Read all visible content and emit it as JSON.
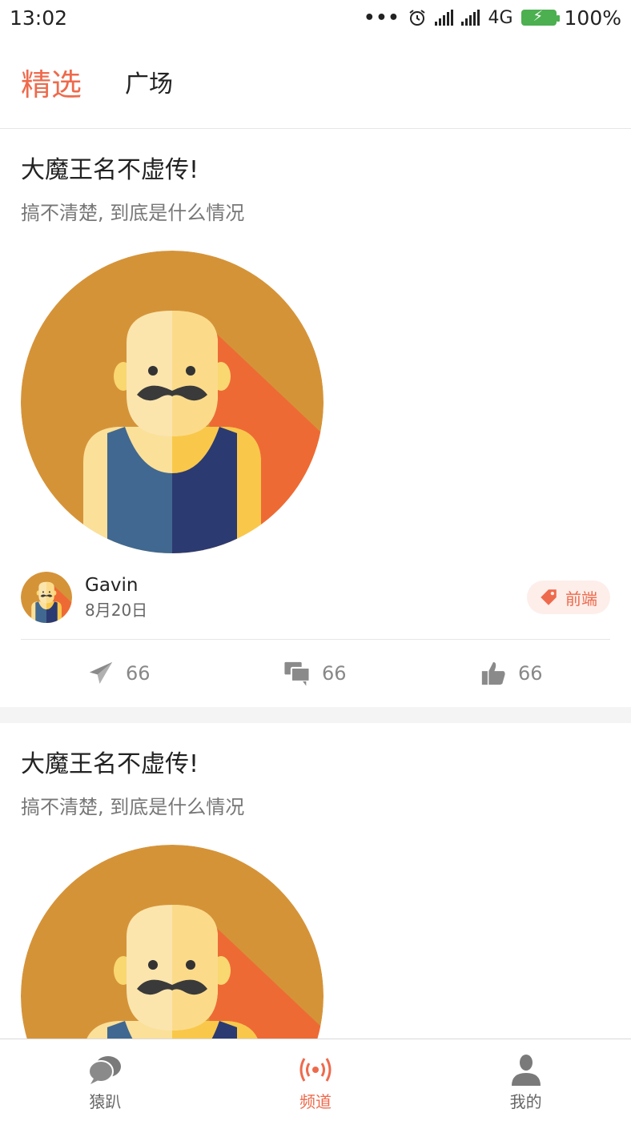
{
  "status_bar": {
    "time": "13:02",
    "dots": "•••",
    "network": "4G",
    "battery": "100%"
  },
  "header": {
    "tabs": [
      {
        "label": "精选",
        "active": true
      },
      {
        "label": "广场",
        "active": false
      }
    ]
  },
  "colors": {
    "accent": "#ee6a4c",
    "avatar_bg": "#d59338",
    "avatar_shadow": "#ee6a34",
    "tank_left": "#416890",
    "tank_right": "#2c3a72"
  },
  "posts": [
    {
      "title": "大魔王名不虚传!",
      "subtitle": "搞不清楚, 到底是什么情况",
      "image_icon": "bald-mustache-man-avatar",
      "author": "Gavin",
      "date": "8月20日",
      "tag": "前端",
      "shares": "66",
      "comments": "66",
      "likes": "66"
    },
    {
      "title": "大魔王名不虚传!",
      "subtitle": "搞不清楚, 到底是什么情况",
      "image_icon": "bald-mustache-man-avatar"
    }
  ],
  "bottom_nav": {
    "items": [
      {
        "label": "猿趴",
        "icon": "chat-bubbles-icon",
        "active": false
      },
      {
        "label": "频道",
        "icon": "broadcast-icon",
        "active": true
      },
      {
        "label": "我的",
        "icon": "user-icon",
        "active": false
      }
    ]
  }
}
